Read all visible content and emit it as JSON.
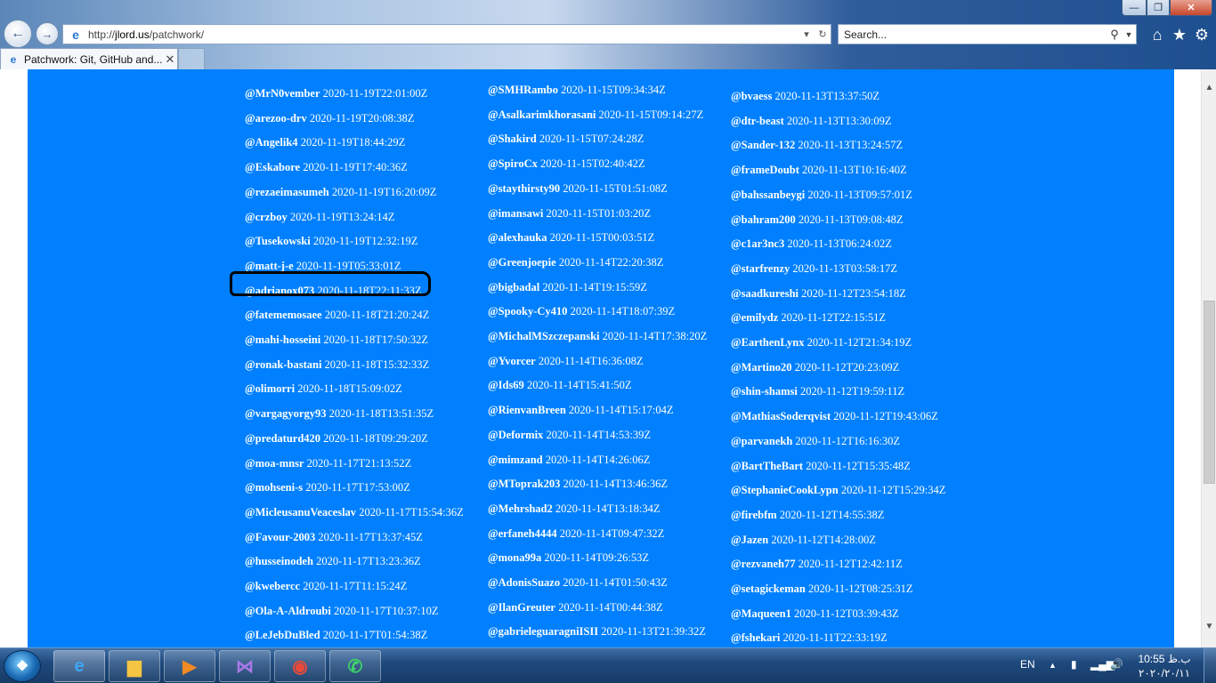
{
  "window": {
    "minimize_glyph": "—",
    "maximize_glyph": "❐",
    "close_glyph": "✕"
  },
  "address_bar": {
    "url_prefix": "http://",
    "url_host": "jlord.us",
    "url_path": "/patchwork/"
  },
  "search": {
    "placeholder": "Search..."
  },
  "tab": {
    "label": "Patchwork: Git, GitHub and..."
  },
  "colors": {
    "page_background": "#0080ff",
    "link_text": "#ffffff",
    "highlight_stroke": "#000000"
  },
  "icons": {
    "back": "back-arrow-icon",
    "forward": "forward-arrow-icon",
    "home": "home-icon",
    "favorites": "star-icon",
    "tools": "gear-icon"
  },
  "columns": [
    {
      "entries": [
        {
          "user": "@MrN0vember",
          "ts": "2020-11-19T22:01:00Z"
        },
        {
          "user": "@arezoo-drv",
          "ts": "2020-11-19T20:08:38Z"
        },
        {
          "user": "@Angelik4",
          "ts": "2020-11-19T18:44:29Z"
        },
        {
          "user": "@Eskabore",
          "ts": "2020-11-19T17:40:36Z"
        },
        {
          "user": "@rezaeimasumeh",
          "ts": "2020-11-19T16:20:09Z"
        },
        {
          "user": "@crzboy",
          "ts": "2020-11-19T13:24:14Z"
        },
        {
          "user": "@Tusekowski",
          "ts": "2020-11-19T12:32:19Z"
        },
        {
          "user": "@matt-j-e",
          "ts": "2020-11-19T05:33:01Z"
        },
        {
          "user": "@adrianox073",
          "ts": "2020-11-18T22:11:33Z"
        },
        {
          "user": "@fatememosaee",
          "ts": "2020-11-18T21:20:24Z"
        },
        {
          "user": "@mahi-hosseini",
          "ts": "2020-11-18T17:50:32Z"
        },
        {
          "user": "@ronak-bastani",
          "ts": "2020-11-18T15:32:33Z"
        },
        {
          "user": "@olimorri",
          "ts": "2020-11-18T15:09:02Z"
        },
        {
          "user": "@vargagyorgy93",
          "ts": "2020-11-18T13:51:35Z"
        },
        {
          "user": "@predaturd420",
          "ts": "2020-11-18T09:29:20Z"
        },
        {
          "user": "@moa-mnsr",
          "ts": "2020-11-17T21:13:52Z"
        },
        {
          "user": "@mohseni-s",
          "ts": "2020-11-17T17:53:00Z"
        },
        {
          "user": "@MicleusanuVeaceslav",
          "ts": "2020-11-17T15:54:36Z"
        },
        {
          "user": "@Favour-2003",
          "ts": "2020-11-17T13:37:45Z"
        },
        {
          "user": "@husseinodeh",
          "ts": "2020-11-17T13:23:36Z"
        },
        {
          "user": "@kwebercc",
          "ts": "2020-11-17T11:15:24Z"
        },
        {
          "user": "@Ola-A-Aldroubi",
          "ts": "2020-11-17T10:37:10Z"
        },
        {
          "user": "@LeJebDuBled",
          "ts": "2020-11-17T01:54:38Z"
        }
      ]
    },
    {
      "entries": [
        {
          "user": "@SMHRambo",
          "ts": "2020-11-15T09:34:34Z"
        },
        {
          "user": "@Asalkarimkhorasani",
          "ts": "2020-11-15T09:14:27Z"
        },
        {
          "user": "@Shakird",
          "ts": "2020-11-15T07:24:28Z"
        },
        {
          "user": "@SpiroCx",
          "ts": "2020-11-15T02:40:42Z"
        },
        {
          "user": "@staythirsty90",
          "ts": "2020-11-15T01:51:08Z"
        },
        {
          "user": "@imansawi",
          "ts": "2020-11-15T01:03:20Z"
        },
        {
          "user": "@alexhauka",
          "ts": "2020-11-15T00:03:51Z"
        },
        {
          "user": "@Greenjoepie",
          "ts": "2020-11-14T22:20:38Z"
        },
        {
          "user": "@bigbadal",
          "ts": "2020-11-14T19:15:59Z"
        },
        {
          "user": "@Spooky-Cy410",
          "ts": "2020-11-14T18:07:39Z"
        },
        {
          "user": "@MichalMSzczepanski",
          "ts": "2020-11-14T17:38:20Z"
        },
        {
          "user": "@Yvorcer",
          "ts": "2020-11-14T16:36:08Z"
        },
        {
          "user": "@Ids69",
          "ts": "2020-11-14T15:41:50Z"
        },
        {
          "user": "@RienvanBreen",
          "ts": "2020-11-14T15:17:04Z"
        },
        {
          "user": "@Deformix",
          "ts": "2020-11-14T14:53:39Z"
        },
        {
          "user": "@mimzand",
          "ts": "2020-11-14T14:26:06Z"
        },
        {
          "user": "@MToprak203",
          "ts": "2020-11-14T13:46:36Z"
        },
        {
          "user": "@Mehrshad2",
          "ts": "2020-11-14T13:18:34Z"
        },
        {
          "user": "@erfaneh4444",
          "ts": "2020-11-14T09:47:32Z"
        },
        {
          "user": "@mona99a",
          "ts": "2020-11-14T09:26:53Z"
        },
        {
          "user": "@AdonisSuazo",
          "ts": "2020-11-14T01:50:43Z"
        },
        {
          "user": "@IlanGreuter",
          "ts": "2020-11-14T00:44:38Z"
        },
        {
          "user": "@gabrieleguaragniISII",
          "ts": "2020-11-13T21:39:32Z"
        }
      ]
    },
    {
      "entries": [
        {
          "user": "@bvaess",
          "ts": "2020-11-13T13:37:50Z"
        },
        {
          "user": "@dtr-beast",
          "ts": "2020-11-13T13:30:09Z"
        },
        {
          "user": "@Sander-132",
          "ts": "2020-11-13T13:24:57Z"
        },
        {
          "user": "@frameDoubt",
          "ts": "2020-11-13T10:16:40Z"
        },
        {
          "user": "@bahssanbeygi",
          "ts": "2020-11-13T09:57:01Z"
        },
        {
          "user": "@bahram200",
          "ts": "2020-11-13T09:08:48Z"
        },
        {
          "user": "@c1ar3nc3",
          "ts": "2020-11-13T06:24:02Z"
        },
        {
          "user": "@starfrenzy",
          "ts": "2020-11-13T03:58:17Z"
        },
        {
          "user": "@saadkureshi",
          "ts": "2020-11-12T23:54:18Z"
        },
        {
          "user": "@emilydz",
          "ts": "2020-11-12T22:15:51Z"
        },
        {
          "user": "@EarthenLynx",
          "ts": "2020-11-12T21:34:19Z"
        },
        {
          "user": "@Martino20",
          "ts": "2020-11-12T20:23:09Z"
        },
        {
          "user": "@shin-shamsi",
          "ts": "2020-11-12T19:59:11Z"
        },
        {
          "user": "@MathiasSoderqvist",
          "ts": "2020-11-12T19:43:06Z"
        },
        {
          "user": "@parvanekh",
          "ts": "2020-11-12T16:16:30Z"
        },
        {
          "user": "@BartTheBart",
          "ts": "2020-11-12T15:35:48Z"
        },
        {
          "user": "@StephanieCookLypn",
          "ts": "2020-11-12T15:29:34Z"
        },
        {
          "user": "@firebfm",
          "ts": "2020-11-12T14:55:38Z"
        },
        {
          "user": "@Jazen",
          "ts": "2020-11-12T14:28:00Z"
        },
        {
          "user": "@rezvaneh77",
          "ts": "2020-11-12T12:42:11Z"
        },
        {
          "user": "@setagickeman",
          "ts": "2020-11-12T08:25:31Z"
        },
        {
          "user": "@Maqueen1",
          "ts": "2020-11-12T03:39:43Z"
        },
        {
          "user": "@fshekari",
          "ts": "2020-11-11T22:33:19Z"
        }
      ]
    }
  ],
  "taskbar": {
    "apps": [
      {
        "name": "Internet Explorer",
        "icon": "internet-explorer-icon",
        "glyph": "e"
      },
      {
        "name": "File Explorer",
        "icon": "folder-icon",
        "glyph": "▆"
      },
      {
        "name": "Media Player",
        "icon": "media-player-icon",
        "glyph": "▶"
      },
      {
        "name": "Visual Studio",
        "icon": "visual-studio-icon",
        "glyph": "⋈"
      },
      {
        "name": "Google Chrome",
        "icon": "chrome-icon",
        "glyph": "◉"
      },
      {
        "name": "WhatsApp",
        "icon": "whatsapp-icon",
        "glyph": "✆"
      }
    ],
    "language": "EN",
    "clock_time": "10:55 ب.ظ",
    "clock_date": "۲۰۲۰/۲۰/۱۱"
  }
}
